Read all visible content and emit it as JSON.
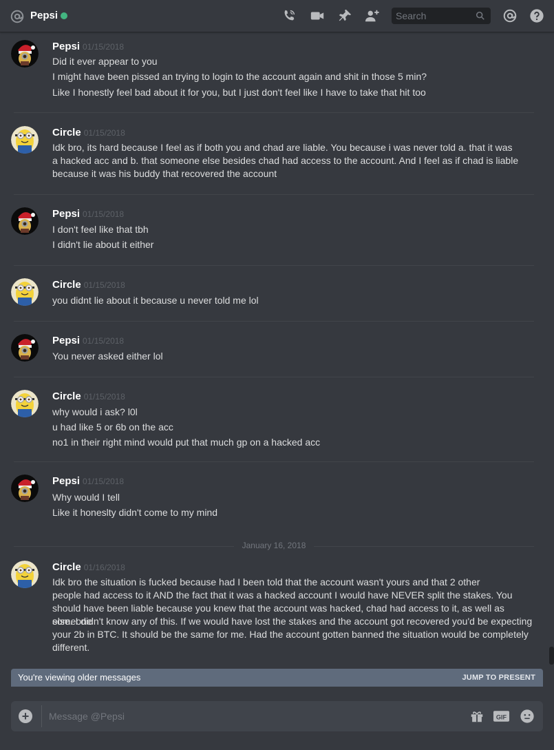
{
  "header": {
    "name": "Pepsi",
    "search_placeholder": "Search"
  },
  "messages": [
    {
      "author": "Pepsi",
      "timestamp": "01/15/2018",
      "avatar": "pepsi-avatar",
      "lines": [
        "Did it ever appear to you",
        "I might have been pissed an trying to login to the account again and shit in those 5 min?",
        "Like I honestly feel bad about it for you, but I just don't feel like I have to take that hit too"
      ]
    },
    {
      "author": "Circle",
      "timestamp": "01/15/2018",
      "avatar": "minion-avatar",
      "lines": [
        "Idk bro, its hard because I feel as if both you and chad are liable. You because i was never told a. that it was",
        "a hacked acc and b. that someone else besides chad had access to the account. And I feel as if chad is liable",
        "because it was his buddy that recovered the account"
      ]
    },
    {
      "author": "Pepsi",
      "timestamp": "01/15/2018",
      "avatar": "pepsi-avatar",
      "lines": [
        "I don't feel like that tbh",
        "I didn't lie about it either"
      ]
    },
    {
      "author": "Circle",
      "timestamp": "01/15/2018",
      "avatar": "minion-avatar",
      "lines": [
        "you didnt lie about it because u never told me lol"
      ]
    },
    {
      "author": "Pepsi",
      "timestamp": "01/15/2018",
      "avatar": "pepsi-avatar",
      "lines": [
        "You never asked either lol"
      ]
    },
    {
      "author": "Circle",
      "timestamp": "01/15/2018",
      "avatar": "minion-avatar",
      "lines": [
        "why would i ask? l0l",
        "u had like 5 or 6b on the acc",
        "no1 in their right mind would put that much gp on a hacked acc"
      ]
    },
    {
      "author": "Pepsi",
      "timestamp": "01/15/2018",
      "avatar": "pepsi-avatar",
      "lines": [
        "Why would I tell",
        "Like it honeslty didn't come to my mind"
      ]
    },
    {
      "author": "Circle",
      "timestamp": "01/16/2018",
      "avatar": "minion-avatar",
      "lines": [
        "Idk bro the situation is fucked because had I been told that the account wasn't yours and that 2 other",
        "people had access to it AND the fact that it was a hacked account I would have NEVER split the stakes. You",
        "should have been liable because you knew that the account was hacked, chad had access to it, as well as someone",
        "else. I didn't know any of this. If we would have lost the stakes and the account got recovered you'd be expecting",
        "your 2b in BTC. It should be the same for me. Had the account gotten banned the situation would be completely",
        "different."
      ]
    }
  ],
  "date_divider": "January 16, 2018",
  "older_bar": {
    "text": "You're viewing older messages",
    "jump": "JUMP TO PRESENT"
  },
  "composer": {
    "placeholder": "Message @Pepsi"
  },
  "colors": {
    "background": "#36393f",
    "online": "#43b581",
    "older_bar": "#5f6b7c"
  }
}
